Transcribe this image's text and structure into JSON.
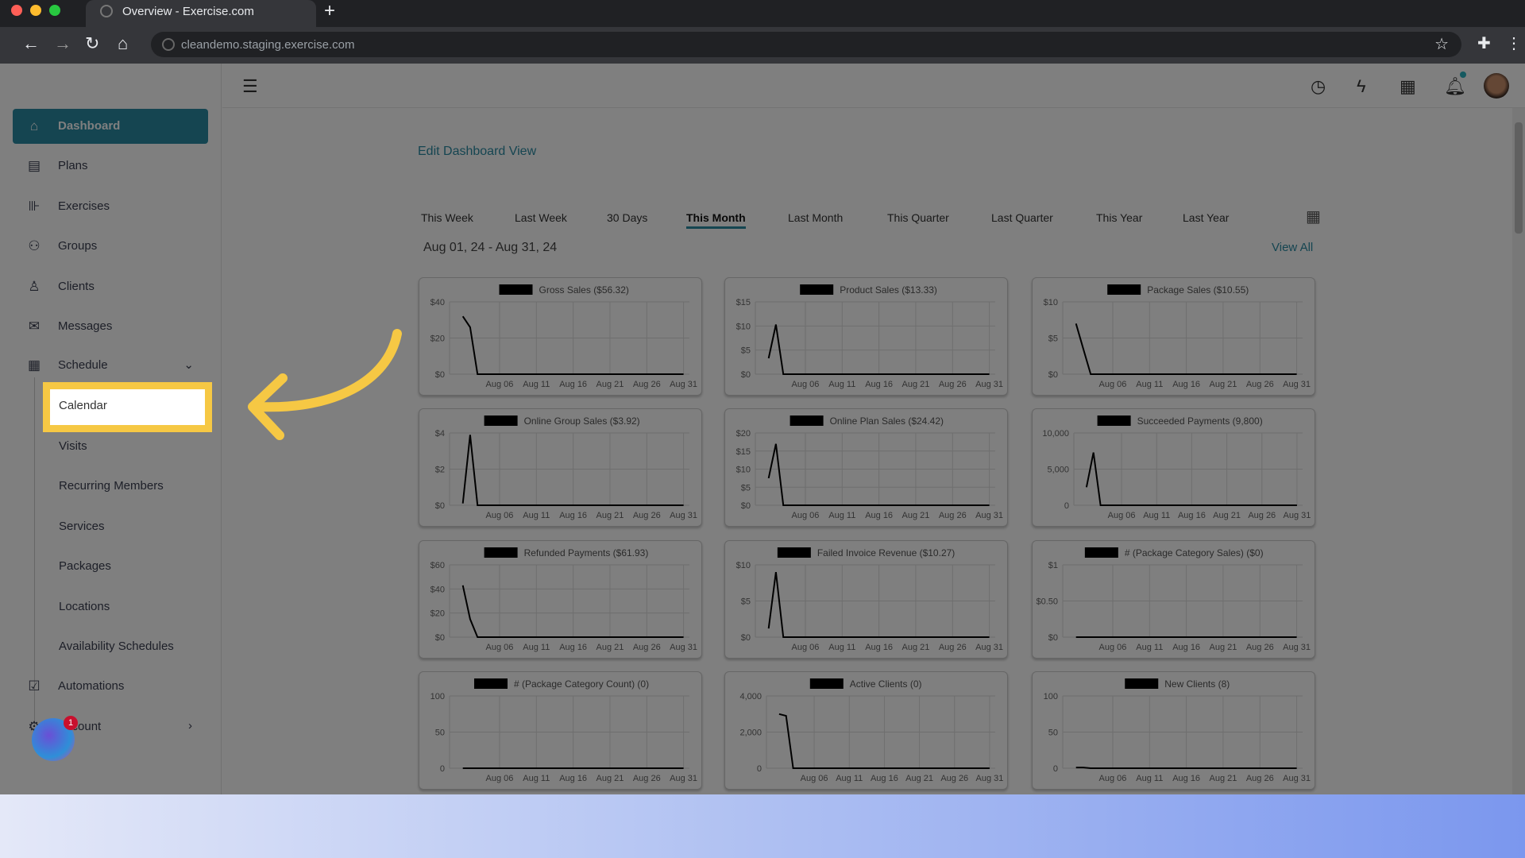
{
  "browser": {
    "tab_title": "Overview - Exercise.com",
    "url": "cleandemo.staging.exercise.com",
    "new_tab": "+"
  },
  "sidebar": {
    "items": [
      {
        "label": "Dashboard",
        "icon": "home-icon",
        "active": true
      },
      {
        "label": "Plans",
        "icon": "clipboard-icon"
      },
      {
        "label": "Exercises",
        "icon": "dumbbell-icon"
      },
      {
        "label": "Groups",
        "icon": "users-icon"
      },
      {
        "label": "Clients",
        "icon": "user-icon"
      },
      {
        "label": "Messages",
        "icon": "mail-icon"
      },
      {
        "label": "Schedule",
        "icon": "calendar-icon",
        "expanded": true
      },
      {
        "label": "Automations",
        "icon": "checkbox-icon"
      },
      {
        "label": "Account",
        "icon": "gear-icon"
      }
    ],
    "schedule_sub": [
      "Calendar",
      "Visits",
      "Recurring Members",
      "Services",
      "Packages",
      "Locations",
      "Availability Schedules"
    ],
    "chat_badge": "1"
  },
  "header": {
    "icons": [
      "history-icon",
      "bolt-icon",
      "apps-grid-icon",
      "bell-icon",
      "avatar"
    ],
    "accent": "#2b8ba3",
    "notif_dot": "#2bb3c0"
  },
  "main": {
    "edit_link": "Edit Dashboard View",
    "periods": [
      "This Week",
      "Last Week",
      "30 Days",
      "This Month",
      "Last Month",
      "This Quarter",
      "Last Quarter",
      "This Year",
      "Last Year"
    ],
    "active_period": "This Month",
    "date_range": "Aug 01, 24 - Aug 31, 24",
    "view_all": "View All"
  },
  "highlight": {
    "color": "#f6c844",
    "target": "Calendar"
  },
  "chart_data": [
    {
      "type": "line",
      "title": "Gross Sales ($56.32)",
      "ylim": [
        0,
        40
      ],
      "yticks": [
        "$0",
        "$20",
        "$40"
      ],
      "xticks": [
        "Aug 06",
        "Aug 11",
        "Aug 16",
        "Aug 21",
        "Aug 26",
        "Aug 31"
      ],
      "values": [
        32,
        26,
        0,
        0,
        0,
        0,
        0,
        0,
        0,
        0,
        0,
        0,
        0,
        0,
        0,
        0,
        0,
        0,
        0,
        0,
        0,
        0,
        0,
        0,
        0,
        0,
        0,
        0,
        0,
        0,
        0
      ]
    },
    {
      "type": "line",
      "title": "Product Sales ($13.33)",
      "ylim": [
        0,
        15
      ],
      "yticks": [
        "$0",
        "$5",
        "$10",
        "$15"
      ],
      "xticks": [
        "Aug 06",
        "Aug 11",
        "Aug 16",
        "Aug 21",
        "Aug 26",
        "Aug 31"
      ],
      "values": [
        3.3,
        10.3,
        0,
        0,
        0,
        0,
        0,
        0,
        0,
        0,
        0,
        0,
        0,
        0,
        0,
        0,
        0,
        0,
        0,
        0,
        0,
        0,
        0,
        0,
        0,
        0,
        0,
        0,
        0,
        0,
        0
      ]
    },
    {
      "type": "line",
      "title": "Package Sales ($10.55)",
      "ylim": [
        0,
        10
      ],
      "yticks": [
        "$0",
        "$5",
        "$10"
      ],
      "xticks": [
        "Aug 06",
        "Aug 11",
        "Aug 16",
        "Aug 21",
        "Aug 26",
        "Aug 31"
      ],
      "values": [
        7,
        3.5,
        0,
        0,
        0,
        0,
        0,
        0,
        0,
        0,
        0,
        0,
        0,
        0,
        0,
        0,
        0,
        0,
        0,
        0,
        0,
        0,
        0,
        0,
        0,
        0,
        0,
        0,
        0,
        0,
        0
      ]
    },
    {
      "type": "line",
      "title": "Online Group Sales ($3.92)",
      "ylim": [
        0,
        4
      ],
      "yticks": [
        "$0",
        "$2",
        "$4"
      ],
      "xticks": [
        "Aug 06",
        "Aug 11",
        "Aug 16",
        "Aug 21",
        "Aug 26",
        "Aug 31"
      ],
      "values": [
        0.1,
        3.9,
        0,
        0,
        0,
        0,
        0,
        0,
        0,
        0,
        0,
        0,
        0,
        0,
        0,
        0,
        0,
        0,
        0,
        0,
        0,
        0,
        0,
        0,
        0,
        0,
        0,
        0,
        0,
        0,
        0
      ]
    },
    {
      "type": "line",
      "title": "Online Plan Sales ($24.42)",
      "ylim": [
        0,
        20
      ],
      "yticks": [
        "$0",
        "$5",
        "$10",
        "$15",
        "$20"
      ],
      "xticks": [
        "Aug 06",
        "Aug 11",
        "Aug 16",
        "Aug 21",
        "Aug 26",
        "Aug 31"
      ],
      "values": [
        7.5,
        17,
        0,
        0,
        0,
        0,
        0,
        0,
        0,
        0,
        0,
        0,
        0,
        0,
        0,
        0,
        0,
        0,
        0,
        0,
        0,
        0,
        0,
        0,
        0,
        0,
        0,
        0,
        0,
        0,
        0
      ]
    },
    {
      "type": "line",
      "title": "Succeeded Payments (9,800)",
      "ylim": [
        0,
        10000
      ],
      "yticks": [
        "0",
        "5,000",
        "10,000"
      ],
      "xticks": [
        "Aug 06",
        "Aug 11",
        "Aug 16",
        "Aug 21",
        "Aug 26",
        "Aug 31"
      ],
      "values": [
        2500,
        7300,
        0,
        0,
        0,
        0,
        0,
        0,
        0,
        0,
        0,
        0,
        0,
        0,
        0,
        0,
        0,
        0,
        0,
        0,
        0,
        0,
        0,
        0,
        0,
        0,
        0,
        0,
        0,
        0,
        0
      ]
    },
    {
      "type": "line",
      "title": "Refunded Payments ($61.93)",
      "ylim": [
        0,
        60
      ],
      "yticks": [
        "$0",
        "$20",
        "$40",
        "$60"
      ],
      "xticks": [
        "Aug 06",
        "Aug 11",
        "Aug 16",
        "Aug 21",
        "Aug 26",
        "Aug 31"
      ],
      "values": [
        43,
        15,
        0,
        0,
        0,
        0,
        0,
        0,
        0,
        0,
        0,
        0,
        0,
        0,
        0,
        0,
        0,
        0,
        0,
        0,
        0,
        0,
        0,
        0,
        0,
        0,
        0,
        0,
        0,
        0,
        0
      ]
    },
    {
      "type": "line",
      "title": "Failed Invoice Revenue ($10.27)",
      "ylim": [
        0,
        10
      ],
      "yticks": [
        "$0",
        "$5",
        "$10"
      ],
      "xticks": [
        "Aug 06",
        "Aug 11",
        "Aug 16",
        "Aug 21",
        "Aug 26",
        "Aug 31"
      ],
      "values": [
        1.2,
        9,
        0,
        0,
        0,
        0,
        0,
        0,
        0,
        0,
        0,
        0,
        0,
        0,
        0,
        0,
        0,
        0,
        0,
        0,
        0,
        0,
        0,
        0,
        0,
        0,
        0,
        0,
        0,
        0,
        0
      ]
    },
    {
      "type": "line",
      "title": "# (Package Category Sales) ($0)",
      "ylim": [
        0,
        1
      ],
      "yticks": [
        "$0",
        "$0.50",
        "$1"
      ],
      "xticks": [
        "Aug 06",
        "Aug 11",
        "Aug 16",
        "Aug 21",
        "Aug 26",
        "Aug 31"
      ],
      "values": [
        0,
        0,
        0,
        0,
        0,
        0,
        0,
        0,
        0,
        0,
        0,
        0,
        0,
        0,
        0,
        0,
        0,
        0,
        0,
        0,
        0,
        0,
        0,
        0,
        0,
        0,
        0,
        0,
        0,
        0,
        0
      ]
    },
    {
      "type": "line",
      "title": "# (Package Category Count) (0)",
      "ylim": [
        0,
        100
      ],
      "yticks": [
        "0",
        "50",
        "100"
      ],
      "xticks": [
        "Aug 06",
        "Aug 11",
        "Aug 16",
        "Aug 21",
        "Aug 26",
        "Aug 31"
      ],
      "values": [
        0,
        0,
        0,
        0,
        0,
        0,
        0,
        0,
        0,
        0,
        0,
        0,
        0,
        0,
        0,
        0,
        0,
        0,
        0,
        0,
        0,
        0,
        0,
        0,
        0,
        0,
        0,
        0,
        0,
        0,
        0
      ]
    },
    {
      "type": "line",
      "title": "Active Clients (0)",
      "ylim": [
        0,
        4000
      ],
      "yticks": [
        "0",
        "2,000",
        "4,000"
      ],
      "xticks": [
        "Aug 06",
        "Aug 11",
        "Aug 16",
        "Aug 21",
        "Aug 26",
        "Aug 31"
      ],
      "values": [
        3000,
        2900,
        0,
        0,
        0,
        0,
        0,
        0,
        0,
        0,
        0,
        0,
        0,
        0,
        0,
        0,
        0,
        0,
        0,
        0,
        0,
        0,
        0,
        0,
        0,
        0,
        0,
        0,
        0,
        0,
        0
      ]
    },
    {
      "type": "line",
      "title": "New Clients (8)",
      "ylim": [
        0,
        100
      ],
      "yticks": [
        "0",
        "50",
        "100"
      ],
      "xticks": [
        "Aug 06",
        "Aug 11",
        "Aug 16",
        "Aug 21",
        "Aug 26",
        "Aug 31"
      ],
      "values": [
        1,
        1,
        0,
        0,
        0,
        0,
        0,
        0,
        0,
        0,
        0,
        0,
        0,
        0,
        0,
        0,
        0,
        0,
        0,
        0,
        0,
        0,
        0,
        0,
        0,
        0,
        0,
        0,
        0,
        0,
        0
      ]
    }
  ]
}
